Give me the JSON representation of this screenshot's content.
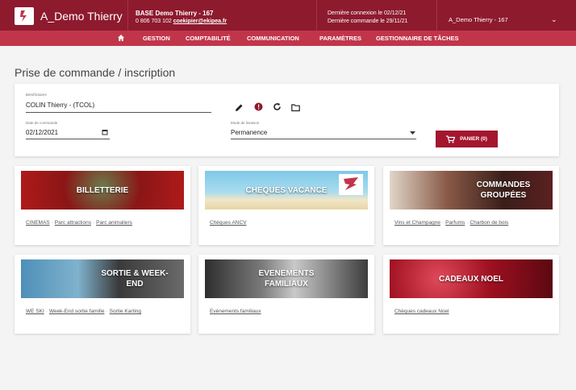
{
  "header": {
    "app_title": "A_Demo Thierry",
    "base_name": "BASE Demo Thierry - 167",
    "phone": "0 806 703 102",
    "email": "coekipier@ekipea.fr",
    "last_login": "Dernière connexion le 02/12/21",
    "last_order": "Dernière commande le 29/11/21",
    "user_name": "A_Demo Thierry - 167"
  },
  "nav": {
    "items": [
      "GESTION",
      "COMPTABILITÉ",
      "COMMUNICATION",
      "PARAMÈTRES",
      "GESTIONNAIRE DE TÂCHES"
    ]
  },
  "page": {
    "title": "Prise de commande / inscription"
  },
  "form": {
    "beneficiary_label": "Bénéficiaires",
    "beneficiary_value": "COLIN Thierry - (TCOL)",
    "date_label": "Date de commande",
    "date_value": "02/12/2021",
    "delivery_label": "Mode de livraison",
    "delivery_value": "Permanence",
    "cart_label": "PANIER (0)"
  },
  "categories": [
    {
      "title": "BILLETTERIE",
      "links": [
        "CINEMAS",
        "Parc attractions",
        "Parc animaliers"
      ]
    },
    {
      "title": "CHEQUES VACANCE",
      "links": [
        "Chèques ANCV"
      ]
    },
    {
      "title": "COMMANDES GROUPÉES",
      "links": [
        "Vins et Champagne",
        "Parfums",
        "Charbon de bois"
      ]
    },
    {
      "title": "SORTIE & WEEK-END",
      "links": [
        "WE SKI",
        "Week-End sortie famille",
        "Sortie Karting"
      ]
    },
    {
      "title": "EVENEMENTS FAMILIAUX",
      "links": [
        "Evènements familiaux"
      ]
    },
    {
      "title": "CADEAUX NOEL",
      "links": [
        "Chèques cadeaux Noel"
      ]
    }
  ],
  "colors": {
    "topbar": "#8e1a2e",
    "navbar": "#c1354b",
    "cart_button": "#a3162e"
  }
}
